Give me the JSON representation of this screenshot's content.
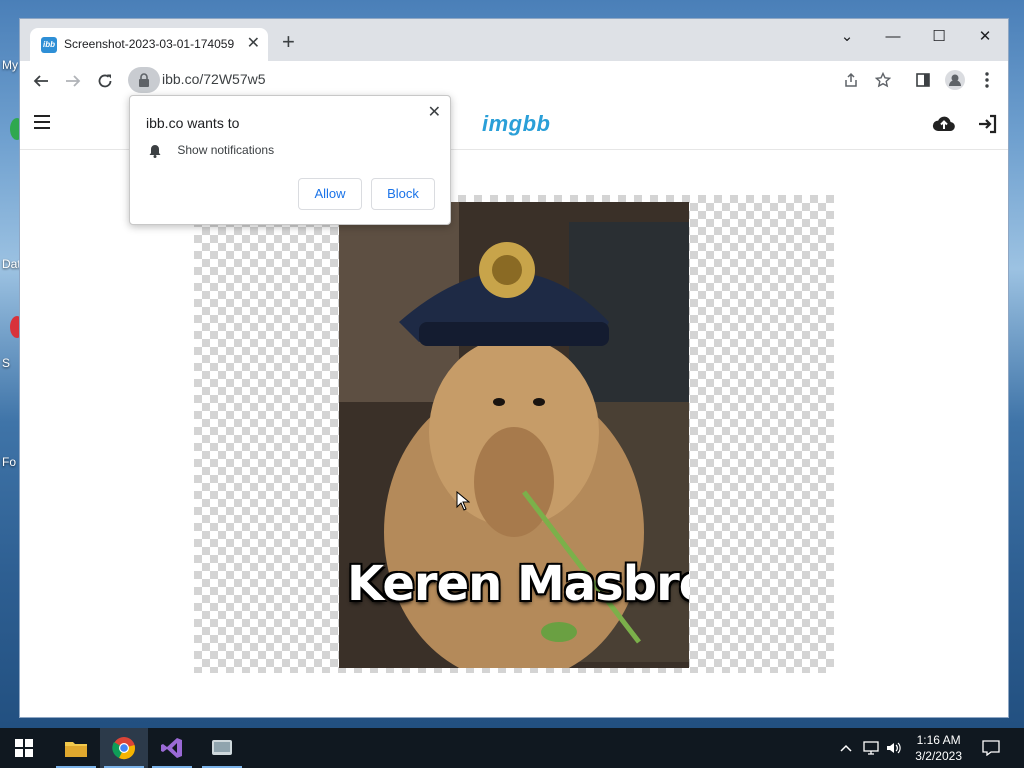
{
  "desktop": {
    "labels": [
      "My",
      "Dat",
      "S",
      "Fo"
    ]
  },
  "browser": {
    "tab": {
      "favicon_text": "ibb",
      "title": "Screenshot-2023-03-01-174059",
      "close": "✕"
    },
    "newtab_label": "+",
    "window_controls": {
      "tab_search": "⌄",
      "minimize": "—",
      "maximize": "☐",
      "close": "✕"
    },
    "url": "ibb.co/72W57w5"
  },
  "site": {
    "logo": "imgbb",
    "image_caption": "Keren Masbro"
  },
  "notification_prompt": {
    "title": "ibb.co wants to",
    "permission": "Show notifications",
    "allow": "Allow",
    "block": "Block",
    "close": "✕"
  },
  "taskbar": {
    "time": "1:16 AM",
    "date": "3/2/2023"
  },
  "colors": {
    "accent": "#2a9fd8",
    "button_text": "#1a73e8",
    "taskbar": "#101820"
  }
}
